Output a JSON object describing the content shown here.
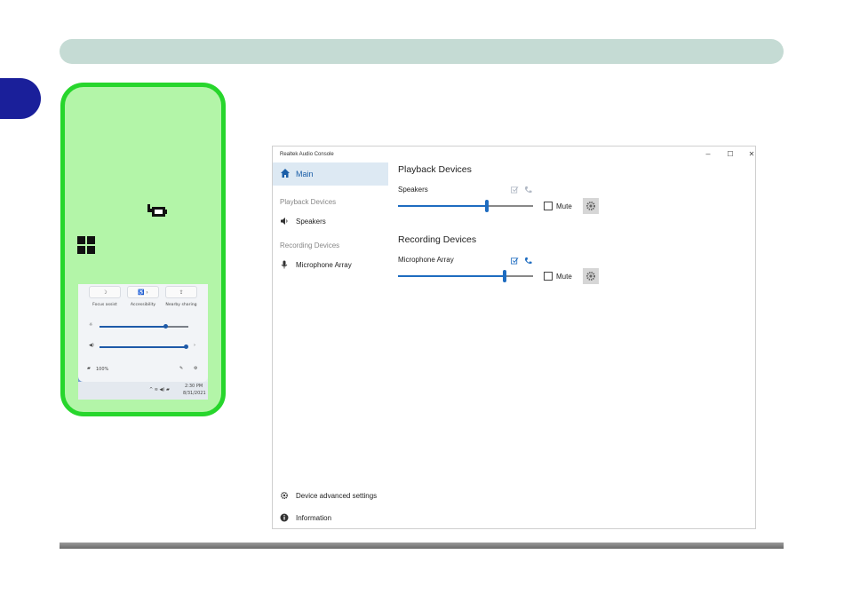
{
  "window": {
    "title": "Realtek Audio Console",
    "minimize": "–",
    "maximize": "☐",
    "close": "✕"
  },
  "sidebar": {
    "main_label": "Main",
    "playback_heading": "Playback Devices",
    "playback_item": "Speakers",
    "recording_heading": "Recording Devices",
    "recording_item": "Microphone Array",
    "advanced_settings": "Device advanced settings",
    "information": "Information"
  },
  "playback": {
    "title": "Playback Devices",
    "device_name": "Speakers",
    "volume_percent": 66,
    "mute_label": "Mute",
    "muted": false
  },
  "recording": {
    "title": "Recording Devices",
    "device_name": "Microphone Array",
    "volume_percent": 79,
    "mute_label": "Mute",
    "muted": false
  },
  "quick_settings": {
    "tile1": "Focus assist",
    "tile2": "Accessibility",
    "tile3": "Nearby sharing",
    "battery": "100%",
    "time": "2:30 PM",
    "date": "8/31/2021"
  },
  "colors": {
    "accent": "#1e6cc0",
    "panel_fill": "#b3f5a8",
    "panel_border": "#27d62c",
    "top_bar": "#c5dbd4",
    "page_tab": "#1a1f9a"
  }
}
